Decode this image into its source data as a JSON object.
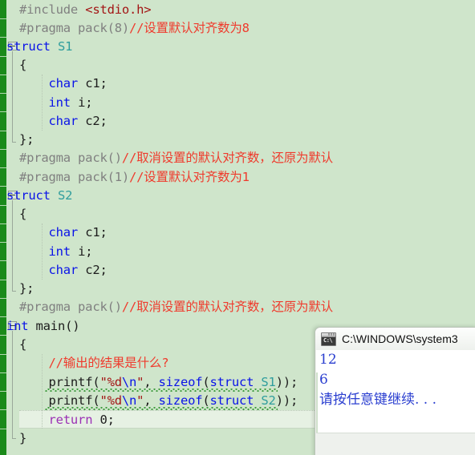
{
  "app": {
    "kind": "c-code-editor-with-console",
    "background_color": "#cfe5cb",
    "change_bar_color": "#1a8a1a"
  },
  "editor": {
    "name": "source-code-view",
    "language": "C",
    "colors": {
      "preprocessor": "#808080",
      "header": "#a31515",
      "comment": "#ef3b2d",
      "keyword": "#0a13e8",
      "type": "#2f9d9d",
      "identifier": "#1c1c1c",
      "string": "#a31515",
      "escape": "#0a13e8",
      "return_keyword": "#9b30b5",
      "squiggle": "#3f9b3f",
      "current_line_highlight": "#e6f1e3"
    },
    "lines": [
      {
        "n": 1,
        "text": "#include <stdio.h>"
      },
      {
        "n": 2,
        "text": "#pragma pack(8)//设置默认对齐数为8"
      },
      {
        "n": 3,
        "text": "struct S1"
      },
      {
        "n": 4,
        "text": "{"
      },
      {
        "n": 5,
        "text": "    char c1;"
      },
      {
        "n": 6,
        "text": "    int i;"
      },
      {
        "n": 7,
        "text": "    char c2;"
      },
      {
        "n": 8,
        "text": "};"
      },
      {
        "n": 9,
        "text": "#pragma pack()//取消设置的默认对齐数，还原为默认"
      },
      {
        "n": 10,
        "text": "#pragma pack(1)//设置默认对齐数为1"
      },
      {
        "n": 11,
        "text": "struct S2"
      },
      {
        "n": 12,
        "text": "{"
      },
      {
        "n": 13,
        "text": "    char c1;"
      },
      {
        "n": 14,
        "text": "    int i;"
      },
      {
        "n": 15,
        "text": "    char c2;"
      },
      {
        "n": 16,
        "text": "};"
      },
      {
        "n": 17,
        "text": "#pragma pack()//取消设置的默认对齐数，还原为默认"
      },
      {
        "n": 18,
        "text": "int main()"
      },
      {
        "n": 19,
        "text": "{"
      },
      {
        "n": 20,
        "text": "    //输出的结果是什么?"
      },
      {
        "n": 21,
        "text": "    printf(\"%d\\n\", sizeof(struct S1));"
      },
      {
        "n": 22,
        "text": "    printf(\"%d\\n\", sizeof(struct S2));"
      },
      {
        "n": 23,
        "text": "    return 0;"
      },
      {
        "n": 24,
        "text": "}"
      }
    ],
    "tokens": {
      "l1": {
        "pp": "#include ",
        "hdr": "<stdio.h>"
      },
      "l2": {
        "pp": "#pragma pack(8)",
        "cmt": "//设置默认对齐数为8"
      },
      "l3": {
        "kw": "struct",
        "type": "S1"
      },
      "l4": {
        "punc": "{"
      },
      "l5": {
        "kw": "char",
        "ident": "c1;"
      },
      "l6": {
        "kw": "int",
        "ident": "i;"
      },
      "l7": {
        "kw": "char",
        "ident": "c2;"
      },
      "l8": {
        "punc": "};"
      },
      "l9": {
        "pp": "#pragma pack()",
        "cmt": "//取消设置的默认对齐数，还原为默认"
      },
      "l10": {
        "pp": "#pragma pack(1)",
        "cmt": "//设置默认对齐数为1"
      },
      "l11": {
        "kw": "struct",
        "type": "S2"
      },
      "l12": {
        "punc": "{"
      },
      "l13": {
        "kw": "char",
        "ident": "c1;"
      },
      "l14": {
        "kw": "int",
        "ident": "i;"
      },
      "l15": {
        "kw": "char",
        "ident": "c2;"
      },
      "l16": {
        "punc": "};"
      },
      "l17": {
        "pp": "#pragma pack()",
        "cmt": "//取消设置的默认对齐数，还原为默认"
      },
      "l18": {
        "kw": "int",
        "ident": "main()"
      },
      "l19": {
        "punc": "{"
      },
      "l20": {
        "cmt": "//输出的结果是什么?"
      },
      "l21": {
        "fn": "printf(",
        "str_open": "\"%d",
        "esc": "\\n",
        "str_close": "\"",
        "mid": ", ",
        "kw2": "sizeof",
        "p2": "(",
        "kw3": "struct",
        "type": "S1",
        "tail": "));"
      },
      "l22": {
        "fn": "printf(",
        "str_open": "\"%d",
        "esc": "\\n",
        "str_close": "\"",
        "mid": ", ",
        "kw2": "sizeof",
        "p2": "(",
        "kw3": "struct",
        "type": "S2",
        "tail": "));"
      },
      "l23": {
        "ret": "return",
        "num": "0;"
      },
      "l24": {
        "punc": "}"
      }
    },
    "fold_markers": [
      {
        "label": "fold-struct-s1",
        "line": 3,
        "state": "expanded",
        "glyph": "minus"
      },
      {
        "label": "fold-struct-s2",
        "line": 11,
        "state": "expanded",
        "glyph": "minus"
      },
      {
        "label": "fold-main",
        "line": 18,
        "state": "expanded",
        "glyph": "minus"
      }
    ],
    "error_squiggles": [
      {
        "line": 21,
        "reason": "printf-statement-underline"
      },
      {
        "line": 22,
        "reason": "printf-statement-underline"
      }
    ],
    "current_line": 23
  },
  "console": {
    "name": "cmd-output-window",
    "title": "C:\\WINDOWS\\system3",
    "icon": "cmd-console-icon",
    "icon_caption": "C:\\",
    "text_color": "#2b3fd0",
    "output": [
      "12",
      "6",
      "请按任意键继续. . ."
    ]
  }
}
